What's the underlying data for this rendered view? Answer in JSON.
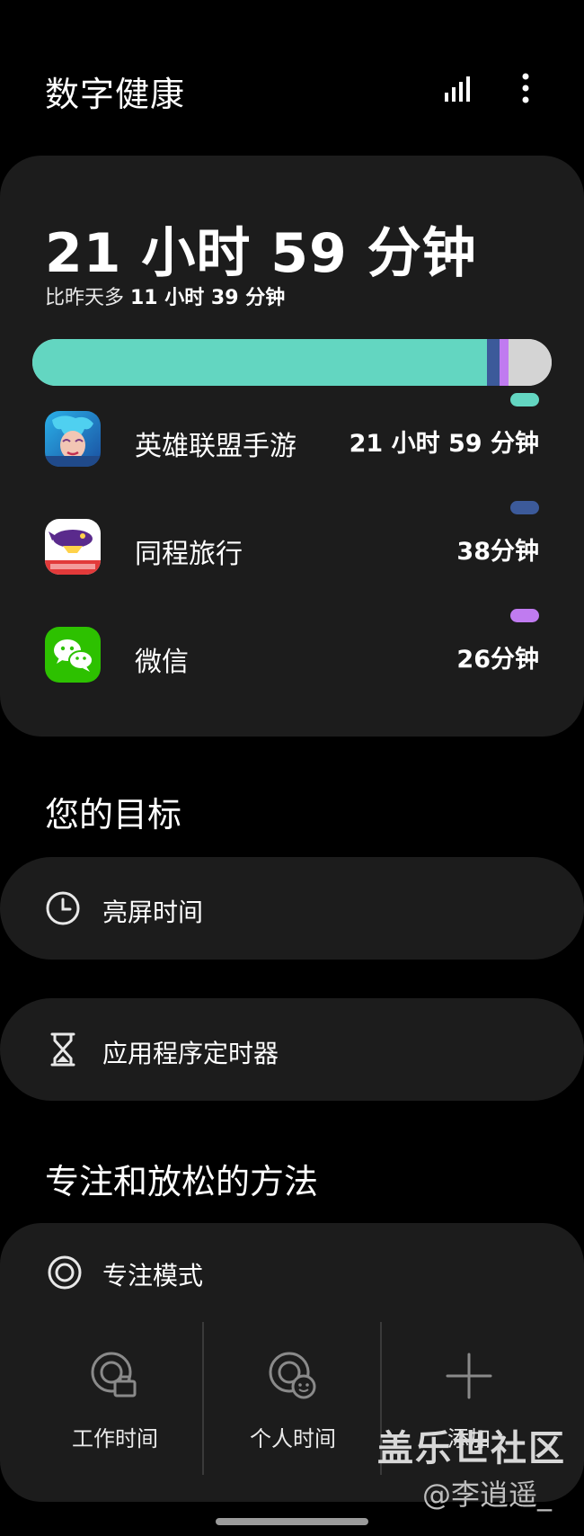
{
  "header": {
    "title": "数字健康",
    "chart_icon": "bar-chart-icon",
    "more_icon": "more-vertical-icon"
  },
  "usage": {
    "total": "21 小时 59 分钟",
    "compare_prefix": "比昨天多 ",
    "compare_value": "11 小时 39 分钟",
    "bar_share": [
      {
        "app": "英雄联盟手游",
        "fraction": 0.875,
        "color": "#63d6c1"
      },
      {
        "app": "同程旅行",
        "fraction": 0.025,
        "color": "#3c5a9a"
      },
      {
        "app": "微信",
        "fraction": 0.017,
        "color": "#c07bf0"
      },
      {
        "app": "other",
        "fraction": 0.083,
        "color": "#d4d4d4"
      }
    ],
    "apps": [
      {
        "name": "英雄联盟手游",
        "time": "21 小时 59 分钟",
        "color": "#63d6c1",
        "icon": "league-of-legends-app-icon"
      },
      {
        "name": "同程旅行",
        "time": "38分钟",
        "color": "#3c5a9a",
        "icon": "tongcheng-travel-app-icon"
      },
      {
        "name": "微信",
        "time": "26分钟",
        "color": "#c07bf0",
        "icon": "wechat-app-icon"
      }
    ]
  },
  "goals": {
    "title": "您的目标",
    "screen_time": "亮屏时间",
    "app_timer": "应用程序定时器"
  },
  "focus": {
    "title": "专注和放松的方法",
    "mode_label": "专注模式",
    "modes": [
      {
        "label": "工作时间",
        "icon": "work-time-icon"
      },
      {
        "label": "个人时间",
        "icon": "personal-time-icon"
      },
      {
        "label": "添加",
        "icon": "add-icon"
      }
    ]
  },
  "watermark": {
    "main": "盖乐世社区",
    "sub": "@李逍遥_"
  }
}
